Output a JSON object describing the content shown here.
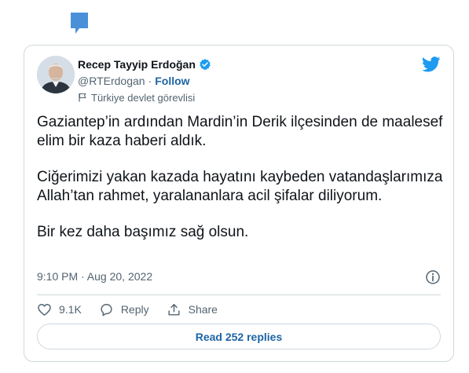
{
  "colors": {
    "accent": "#1d9bf0",
    "link": "#1d64a6",
    "text": "#0f1419",
    "muted": "#536471",
    "border": "#cfd9de"
  },
  "tweet": {
    "author_name": "Recep Tayyip Erdoğan",
    "handle": "@RTErdogan",
    "separator": "·",
    "follow_label": "Follow",
    "account_label": "Türkiye devlet görevlisi",
    "paragraphs": [
      "Gaziantep’in ardından Mardin’in Derik ilçesinden de maalesef elim bir kaza haberi aldık.",
      "Ciğerimizi yakan kazada hayatını kaybeden vatandaşlarımıza Allah’tan rahmet, yaralananlara acil şifalar diliyorum.",
      "Bir kez daha başımız sağ olsun."
    ],
    "timestamp": "9:10 PM · Aug 20, 2022",
    "likes": "9.1K",
    "reply_label": "Reply",
    "share_label": "Share",
    "read_replies_label": "Read 252 replies"
  },
  "icons": {
    "marker": "comment-bookmark-icon",
    "verified": "verified-badge-icon",
    "brand": "twitter-bird-icon",
    "label": "flag-icon",
    "info": "info-icon",
    "like": "heart-icon",
    "reply": "reply-bubble-icon",
    "share": "share-upload-icon"
  }
}
